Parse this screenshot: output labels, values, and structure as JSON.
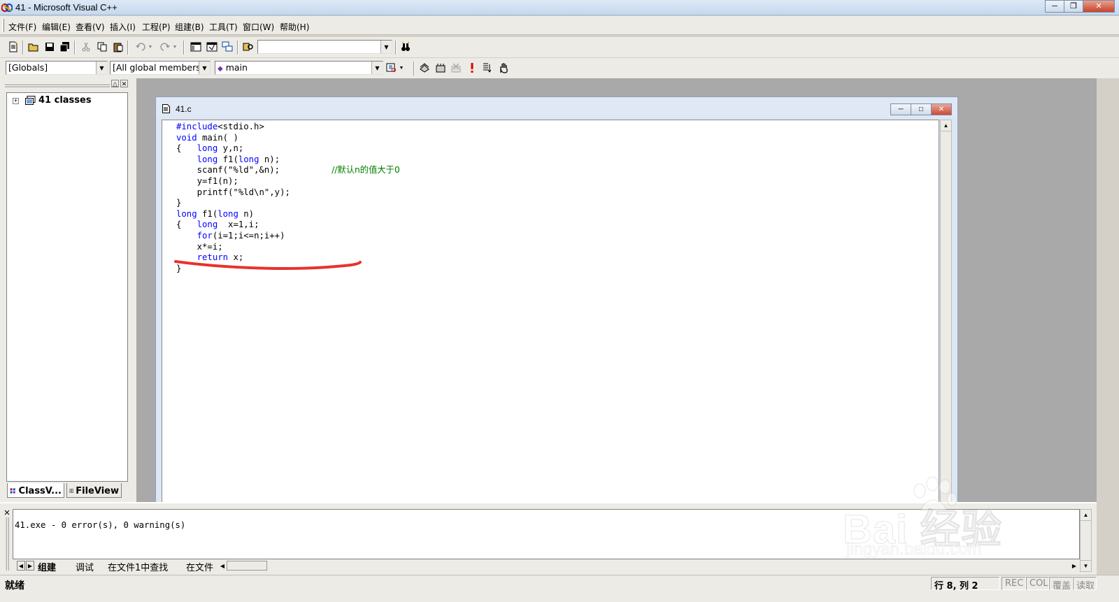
{
  "window": {
    "title": "41 - Microsoft Visual C++"
  },
  "menu": [
    "文件(F)",
    "编辑(E)",
    "查看(V)",
    "插入(I)",
    "工程(P)",
    "组建(B)",
    "工具(T)",
    "窗口(W)",
    "帮助(H)"
  ],
  "toolbar": {
    "find_combo_value": ""
  },
  "wizardbar": {
    "scope": "[Globals]",
    "filter": "[All global members",
    "member": "main"
  },
  "workspace": {
    "tree_root": "41 classes",
    "tabs": [
      "ClassV...",
      "FileView"
    ]
  },
  "editor": {
    "doc_title": "41.c",
    "lines": [
      [
        {
          "t": "#include",
          "c": "kw"
        },
        {
          "t": "<stdio.h>"
        }
      ],
      [
        {
          "t": "void",
          "c": "kw"
        },
        {
          "t": " main( )"
        }
      ],
      [
        {
          "t": "{   "
        },
        {
          "t": "long",
          "c": "kw"
        },
        {
          "t": " y,n;"
        }
      ],
      [
        {
          "t": "    "
        },
        {
          "t": "long",
          "c": "kw"
        },
        {
          "t": " f1("
        },
        {
          "t": "long",
          "c": "kw"
        },
        {
          "t": " n);"
        }
      ],
      [
        {
          "t": "    scanf(\"%ld\",&n);          "
        },
        {
          "t": "//默认n的值大于0",
          "c": "cm"
        }
      ],
      [
        {
          "t": "    y=f1(n);"
        }
      ],
      [
        {
          "t": "    printf(\"%ld\\n\",y);"
        }
      ],
      [
        {
          "t": "}"
        }
      ],
      [
        {
          "t": "long",
          "c": "kw"
        },
        {
          "t": " f1("
        },
        {
          "t": "long",
          "c": "kw"
        },
        {
          "t": " n)"
        }
      ],
      [
        {
          "t": "{   "
        },
        {
          "t": "long",
          "c": "kw"
        },
        {
          "t": "  x=1,i;"
        }
      ],
      [
        {
          "t": "    "
        },
        {
          "t": "for",
          "c": "kw"
        },
        {
          "t": "(i=1;i<=n;i++)"
        }
      ],
      [
        {
          "t": "    x*=i;"
        }
      ],
      [
        {
          "t": "    "
        },
        {
          "t": "return",
          "c": "kw"
        },
        {
          "t": " x;"
        }
      ],
      [
        {
          "t": "}"
        }
      ]
    ]
  },
  "output": {
    "text": "41.exe - 0 error(s), 0 warning(s)",
    "tabs": [
      "组建",
      "调试",
      "在文件1中查找",
      "在文件"
    ]
  },
  "status": {
    "message": "就绪",
    "position": "行 8, 列 2",
    "indicators": [
      "REC",
      "COL",
      "覆盖",
      "读取"
    ]
  },
  "watermark": {
    "brand": "Bai 经验",
    "url": "jingyan.baidu.com"
  },
  "colors": {
    "keyword": "#0000ff",
    "comment": "#008000",
    "annotation": "#e8322c"
  }
}
